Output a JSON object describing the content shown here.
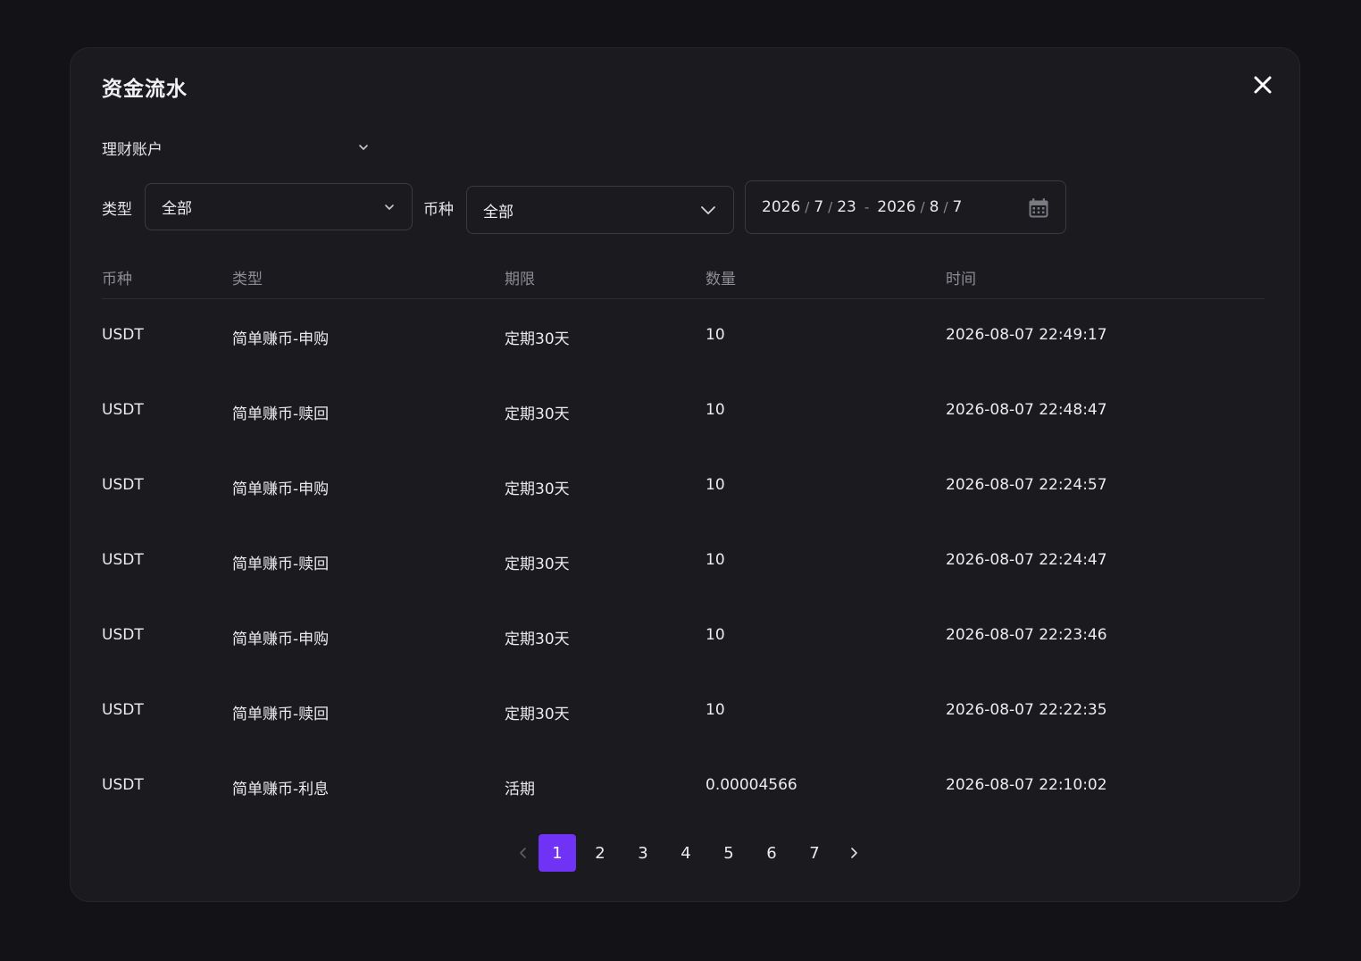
{
  "modal": {
    "title": "资金流水"
  },
  "account": {
    "selected": "理财账户"
  },
  "filters": {
    "type_label": "类型",
    "type_value": "全部",
    "coin_label": "币种",
    "coin_value": "全部",
    "date_range": {
      "start": {
        "year": "2026",
        "month": "7",
        "day": "23"
      },
      "end": {
        "year": "2026",
        "month": "8",
        "day": "7"
      },
      "separator": "/",
      "dash": "-"
    }
  },
  "table": {
    "headers": [
      "币种",
      "类型",
      "期限",
      "数量",
      "时间"
    ],
    "rows": [
      [
        "USDT",
        "简单赚币-申购",
        "定期30天",
        "10",
        "2026-08-07 22:49:17"
      ],
      [
        "USDT",
        "简单赚币-赎回",
        "定期30天",
        "10",
        "2026-08-07 22:48:47"
      ],
      [
        "USDT",
        "简单赚币-申购",
        "定期30天",
        "10",
        "2026-08-07 22:24:57"
      ],
      [
        "USDT",
        "简单赚币-赎回",
        "定期30天",
        "10",
        "2026-08-07 22:24:47"
      ],
      [
        "USDT",
        "简单赚币-申购",
        "定期30天",
        "10",
        "2026-08-07 22:23:46"
      ],
      [
        "USDT",
        "简单赚币-赎回",
        "定期30天",
        "10",
        "2026-08-07 22:22:35"
      ],
      [
        "USDT",
        "简单赚币-利息",
        "活期",
        "0.00004566",
        "2026-08-07 22:10:02"
      ]
    ]
  },
  "pagination": {
    "pages": [
      "1",
      "2",
      "3",
      "4",
      "5",
      "6",
      "7"
    ],
    "current": "1"
  },
  "colors": {
    "accent": "#7033f5",
    "background": "#121217",
    "panel": "#1b1b1f"
  },
  "icons": {
    "close": "close-icon",
    "chevron": "chevron-down-icon",
    "calendar": "calendar-icon",
    "prev": "chevron-left-icon",
    "next": "chevron-right-icon"
  }
}
